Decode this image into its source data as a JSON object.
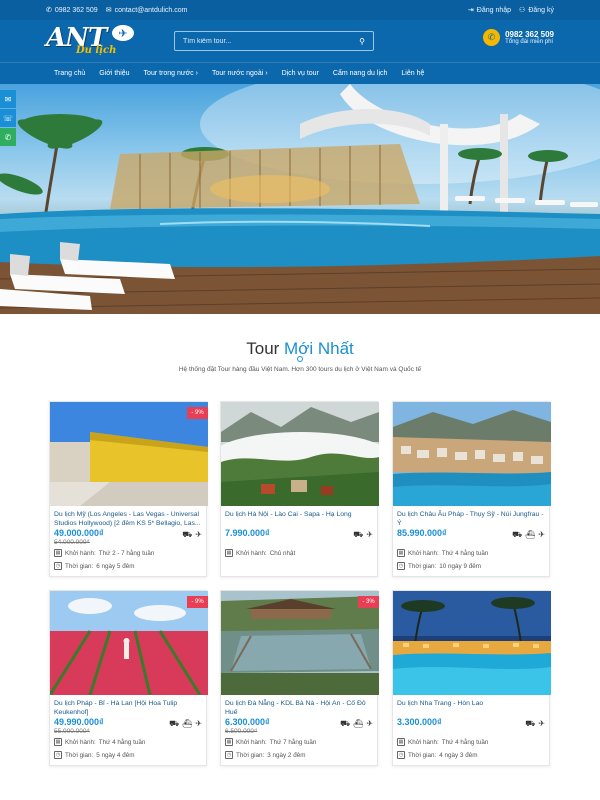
{
  "topbar": {
    "phone": "0982 362 509",
    "email": "contact@antdulich.com",
    "login": "Đăng nhập",
    "register": "Đăng ký"
  },
  "logo": {
    "main": "ANT",
    "sub": "Du lịch"
  },
  "search": {
    "placeholder": "Tìm kiếm tour..."
  },
  "hotline": {
    "number": "0982 362 509",
    "label": "Tổng đài miễn phí"
  },
  "nav": [
    "Trang chủ",
    "Giới thiệu",
    "Tour trong nước ›",
    "Tour nước ngoài ›",
    "Dịch vụ tour",
    "Cẩm nang du lịch",
    "Liên hệ"
  ],
  "section": {
    "title_part1": "Tour",
    "title_part2": "Mới Nhất",
    "description": "Hệ thống đặt Tour hàng đầu Việt Nam. Hơn 300 tours du lịch ở Việt Nam và Quốc tế"
  },
  "labels": {
    "departure_prefix": "Khởi hành: ",
    "duration_prefix": "Thời gian: "
  },
  "tours": [
    {
      "name": "Du lịch Mỹ (Los Angeles - Las Vegas - Universal Studios Hollywood) [2 đêm KS 5* Bellagio, Las...",
      "price": "49.000.000₫",
      "old_price": "54.000.000₫",
      "badge": "- 9%",
      "departure": "Thứ 2 - 7 hằng tuần",
      "duration": "6 ngày 5 đêm",
      "transport": "bus plane"
    },
    {
      "name": "Du lịch Hà Nội - Lào Cai - Sapa - Hạ Long",
      "price": "7.990.000₫",
      "old_price": "",
      "badge": "",
      "departure": "Chủ nhật",
      "duration": "",
      "transport": "bus plane"
    },
    {
      "name": "Du lịch Châu Âu Pháp - Thụy Sỹ - Núi Jungfrau - Ý",
      "price": "85.990.000₫",
      "old_price": "",
      "badge": "",
      "departure": "Thứ 4 hằng tuần",
      "duration": "10 ngày 9 đêm",
      "transport": "bus ship plane"
    },
    {
      "name": "Du lịch Pháp - Bỉ - Hà Lan [Hội Hoa Tulip Keukenhof]",
      "price": "49.990.000₫",
      "old_price": "55.000.000₫",
      "badge": "- 9%",
      "departure": "Thứ 4 hằng tuần",
      "duration": "5 ngày 4 đêm",
      "transport": "bus ship plane"
    },
    {
      "name": "Du lịch Đà Nẵng - KDL Bà Nà - Hội An - Cố Đô Huế",
      "price": "6.300.000₫",
      "old_price": "6.500.000₫",
      "badge": "- 3%",
      "departure": "Thứ 7 hằng tuần",
      "duration": "3 ngày 2 đêm",
      "transport": "bus ship plane"
    },
    {
      "name": "Du lịch Nha Trang - Hòn Lao",
      "price": "3.300.000₫",
      "old_price": "",
      "badge": "",
      "departure": "Thứ 4 hằng tuần",
      "duration": "4 ngày 3 đêm",
      "transport": "bus plane"
    }
  ]
}
